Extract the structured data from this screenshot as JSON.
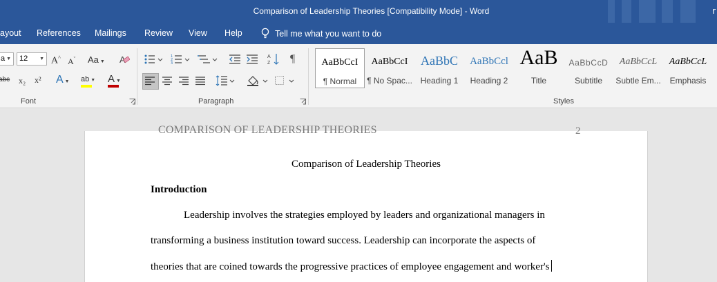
{
  "window": {
    "title": "Comparison of Leadership Theories [Compatibility Mode]  -  Word",
    "user_initial": "r"
  },
  "tabs": [
    "ayout",
    "References",
    "Mailings",
    "Review",
    "View",
    "Help"
  ],
  "tell_me": "Tell me what you want to do",
  "font_group": {
    "font_name": "a",
    "font_size": "12",
    "label": "Font",
    "grow_glyph": "A",
    "shrink_glyph": "A",
    "case_glyph": "Aa",
    "strike_glyph": "abc",
    "subscript_glyph": "x₂",
    "superscript_glyph": "x²",
    "effects_glyph": "A",
    "highlight_glyph": "ab",
    "color_glyph": "A",
    "highlight_color": "#ffff00",
    "font_color": "#c00000"
  },
  "paragraph_group": {
    "label": "Paragraph",
    "pilcrow": "¶"
  },
  "styles_group": {
    "label": "Styles",
    "items": [
      {
        "preview": "AaBbCcI",
        "name": "¶ Normal"
      },
      {
        "preview": "AaBbCcI",
        "name": "¶ No Spac..."
      },
      {
        "preview": "AaBbC",
        "name": "Heading 1"
      },
      {
        "preview": "AaBbCcl",
        "name": "Heading 2"
      },
      {
        "preview": "AaB",
        "name": "Title"
      },
      {
        "preview": "AaBbCcD",
        "name": "Subtitle"
      },
      {
        "preview": "AaBbCcL",
        "name": "Subtle Em..."
      },
      {
        "preview": "AaBbCcL",
        "name": "Emphasis"
      }
    ]
  },
  "document": {
    "running_head": "COMPARISON OF LEADERSHIP THEORIES",
    "page_number": "2",
    "title": "Comparison of Leadership Theories",
    "heading": "Introduction",
    "lines": [
      "Leadership involves the strategies employed by leaders and organizational managers in",
      "transforming a business institution toward success. Leadership can incorporate the aspects of",
      "theories that are coined towards the progressive practices of employee engagement and worker's"
    ]
  },
  "colors": {
    "accent": "#2b579a",
    "ribbon": "#f3f3f3",
    "canvas": "#e6e6e6"
  }
}
